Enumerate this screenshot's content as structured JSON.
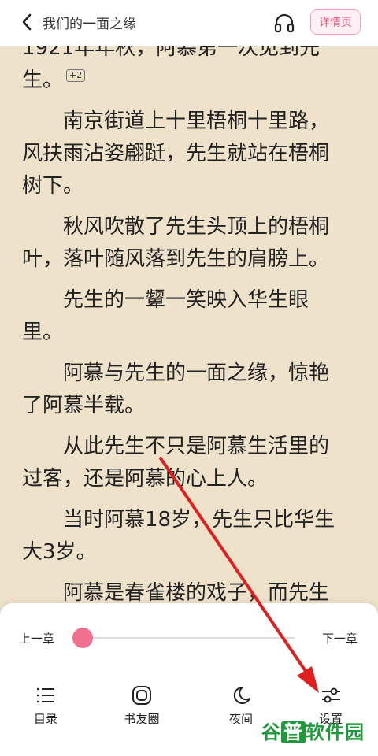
{
  "header": {
    "title": "我们的一面之缘",
    "detail_label": "详情页"
  },
  "article": {
    "paragraphs": [
      "1921年年秋，阿慕第一次见到先生。",
      "南京街道上十里梧桐十里路，风扶雨沾姿翩跹，先生就站在梧桐树下。",
      "秋风吹散了先生头顶上的梧桐叶，落叶随风落到先生的肩膀上。",
      "先生的一颦一笑映入华生眼里。",
      "阿慕与先生的一面之缘，惊艳了阿慕半载。",
      "从此先生不只是阿慕生活里的过客，还是阿慕的心上人。",
      "当时阿慕18岁，先生只比华生大3岁。",
      "阿慕是春雀楼的戏子，而先生"
    ],
    "comment_badge": "+2"
  },
  "controls": {
    "prev_chapter": "上一章",
    "next_chapter": "下一章",
    "progress": 0.0
  },
  "nav": {
    "catalog": "目录",
    "book_circle": "书友圈",
    "night": "夜间",
    "settings": "设置"
  },
  "watermark": {
    "text_part1": "谷",
    "text_part2": "普",
    "text_part3": "软件园"
  },
  "colors": {
    "accent_pink": "#f0708f",
    "background_page": "#efe2cb",
    "arrow_red": "#e02020"
  },
  "icons": {
    "back": "chevron-left-icon",
    "headphone": "headphone-icon",
    "catalog": "list-icon",
    "book_circle": "rounded-square-icon",
    "night": "moon-icon",
    "settings": "sliders-icon"
  }
}
